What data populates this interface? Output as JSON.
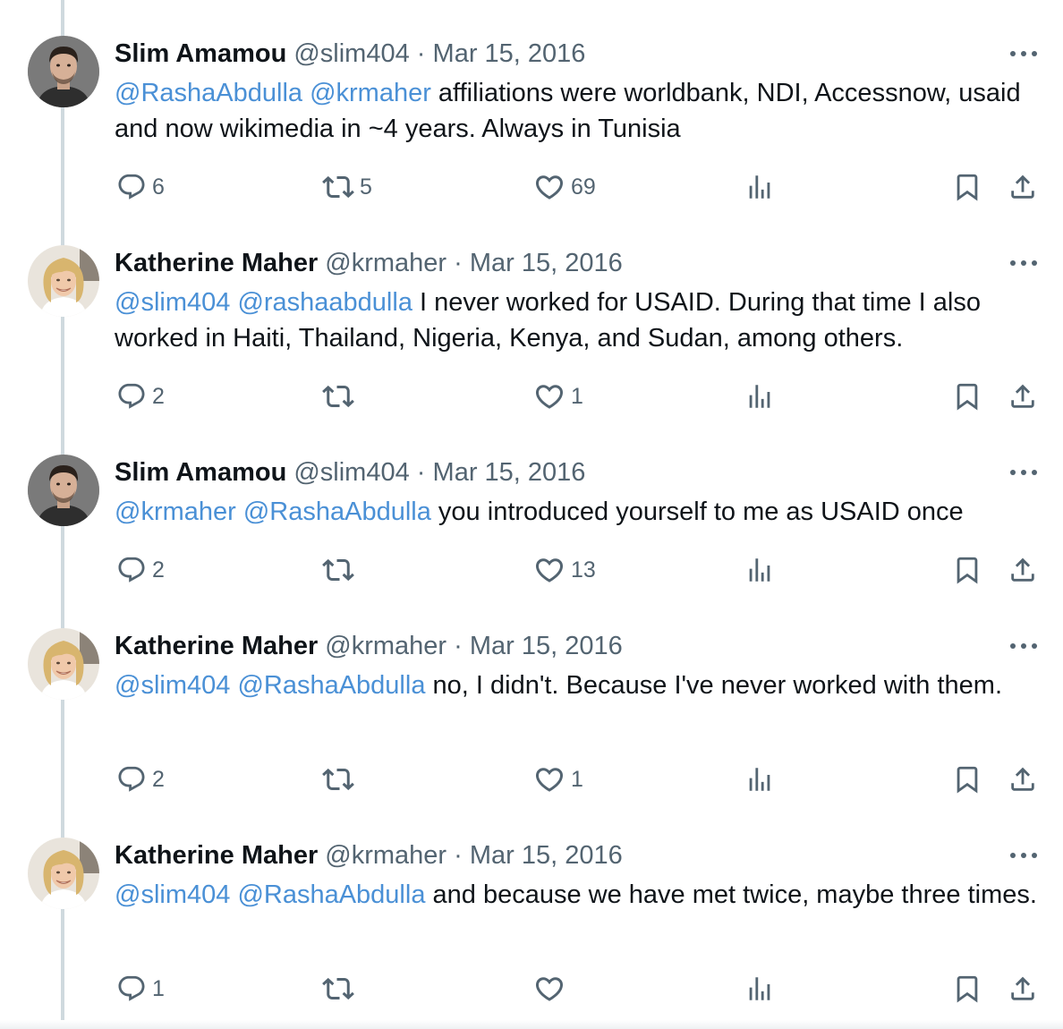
{
  "colors": {
    "mention": "#4a90d6",
    "secondary_text": "#536471",
    "thread_line": "#cfd9de"
  },
  "tweets": [
    {
      "author": "Slim Amamou",
      "handle": "@slim404",
      "separator": "·",
      "date": "Mar 15, 2016",
      "mentions": [
        "@RashaAbdulla",
        "@krmaher"
      ],
      "text": " affiliations were worldbank, NDI, Accessnow, usaid and now wikimedia in ~4 years. Always in Tunisia",
      "replies": "6",
      "retweets": "5",
      "likes": "69",
      "avatar_icon": "man-avatar"
    },
    {
      "author": "Katherine Maher",
      "handle": "@krmaher",
      "separator": "·",
      "date": "Mar 15, 2016",
      "mentions": [
        "@slim404",
        "@rashaabdulla"
      ],
      "text": " I never worked for USAID. During that time I also worked in Haiti, Thailand, Nigeria, Kenya, and Sudan, among others.",
      "replies": "2",
      "retweets": "",
      "likes": "1",
      "avatar_icon": "woman-avatar"
    },
    {
      "author": "Slim Amamou",
      "handle": "@slim404",
      "separator": "·",
      "date": "Mar 15, 2016",
      "mentions": [
        "@krmaher",
        "@RashaAbdulla"
      ],
      "text": " you introduced yourself to me as USAID once",
      "replies": "2",
      "retweets": "",
      "likes": "13",
      "avatar_icon": "man-avatar"
    },
    {
      "author": "Katherine Maher",
      "handle": "@krmaher",
      "separator": "·",
      "date": "Mar 15, 2016",
      "mentions": [
        "@slim404",
        "@RashaAbdulla"
      ],
      "text": " no, I didn't. Because I've never worked with them.",
      "replies": "2",
      "retweets": "",
      "likes": "1",
      "avatar_icon": "woman-avatar"
    },
    {
      "author": "Katherine Maher",
      "handle": "@krmaher",
      "separator": "·",
      "date": "Mar 15, 2016",
      "mentions": [
        "@slim404",
        "@RashaAbdulla"
      ],
      "text": " and because we have met twice, maybe three times.",
      "replies": "1",
      "retweets": "",
      "likes": "",
      "avatar_icon": "woman-avatar"
    }
  ]
}
